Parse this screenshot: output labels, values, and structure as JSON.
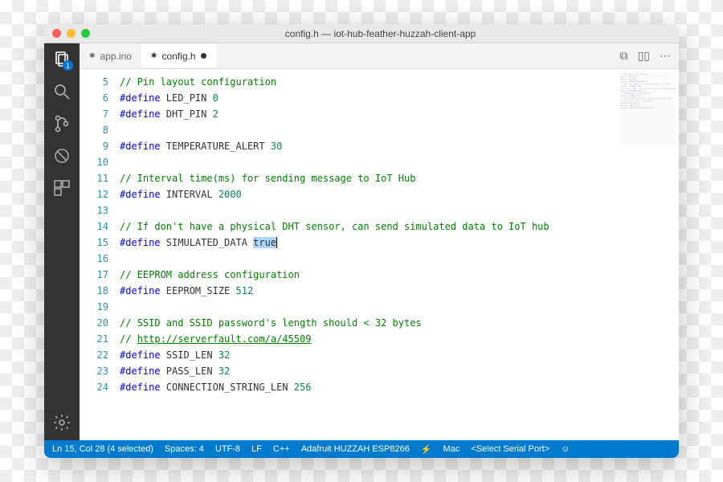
{
  "window_title": "config.h — iot-hub-feather-huzzah-client-app",
  "activity_badge": "1",
  "tabs": [
    {
      "label": "app.ino",
      "modified": true,
      "active": false
    },
    {
      "label": "config.h",
      "modified": true,
      "active": true
    }
  ],
  "lines": [
    {
      "n": 5,
      "tokens": [
        [
          "c-comment",
          "// Pin layout configuration"
        ]
      ]
    },
    {
      "n": 6,
      "tokens": [
        [
          "c-macro",
          "#define"
        ],
        [
          "",
          " LED_PIN "
        ],
        [
          "c-number",
          "0"
        ]
      ]
    },
    {
      "n": 7,
      "tokens": [
        [
          "c-macro",
          "#define"
        ],
        [
          "",
          " DHT_PIN "
        ],
        [
          "c-number",
          "2"
        ]
      ]
    },
    {
      "n": 8,
      "tokens": []
    },
    {
      "n": 9,
      "tokens": [
        [
          "c-macro",
          "#define"
        ],
        [
          "",
          " TEMPERATURE_ALERT "
        ],
        [
          "c-number",
          "30"
        ]
      ]
    },
    {
      "n": 10,
      "tokens": []
    },
    {
      "n": 11,
      "tokens": [
        [
          "c-comment",
          "// Interval time(ms) for sending message to IoT Hub"
        ]
      ]
    },
    {
      "n": 12,
      "tokens": [
        [
          "c-macro",
          "#define"
        ],
        [
          "",
          " INTERVAL "
        ],
        [
          "c-number",
          "2000"
        ]
      ]
    },
    {
      "n": 13,
      "tokens": []
    },
    {
      "n": 14,
      "tokens": [
        [
          "c-comment",
          "// If don't have a physical DHT sensor, can send simulated data to IoT hub"
        ]
      ]
    },
    {
      "n": 15,
      "tokens": [
        [
          "c-macro",
          "#define"
        ],
        [
          "",
          " SIMULATED_DATA "
        ],
        [
          "sel",
          "true"
        ]
      ]
    },
    {
      "n": 16,
      "tokens": []
    },
    {
      "n": 17,
      "tokens": [
        [
          "c-comment",
          "// EEPROM address configuration"
        ]
      ]
    },
    {
      "n": 18,
      "tokens": [
        [
          "c-macro",
          "#define"
        ],
        [
          "",
          " EEPROM_SIZE "
        ],
        [
          "c-number",
          "512"
        ]
      ]
    },
    {
      "n": 19,
      "tokens": []
    },
    {
      "n": 20,
      "tokens": [
        [
          "c-comment",
          "// SSID and SSID password's length should < 32 bytes"
        ]
      ]
    },
    {
      "n": 21,
      "tokens": [
        [
          "c-comment",
          "// "
        ],
        [
          "c-link",
          "http://serverfault.com/a/45509"
        ]
      ]
    },
    {
      "n": 22,
      "tokens": [
        [
          "c-macro",
          "#define"
        ],
        [
          "",
          " SSID_LEN "
        ],
        [
          "c-number",
          "32"
        ]
      ]
    },
    {
      "n": 23,
      "tokens": [
        [
          "c-macro",
          "#define"
        ],
        [
          "",
          " PASS_LEN "
        ],
        [
          "c-number",
          "32"
        ]
      ]
    },
    {
      "n": 24,
      "tokens": [
        [
          "c-macro",
          "#define"
        ],
        [
          "",
          " CONNECTION_STRING_LEN "
        ],
        [
          "c-number",
          "256"
        ]
      ]
    }
  ],
  "status": {
    "cursor": "Ln 15, Col 28 (4 selected)",
    "spaces": "Spaces: 4",
    "encoding": "UTF-8",
    "eol": "LF",
    "lang": "C++",
    "board": "Adafruit HUZZAH ESP8266",
    "platform": "Mac",
    "serial": "<Select Serial Port>"
  }
}
